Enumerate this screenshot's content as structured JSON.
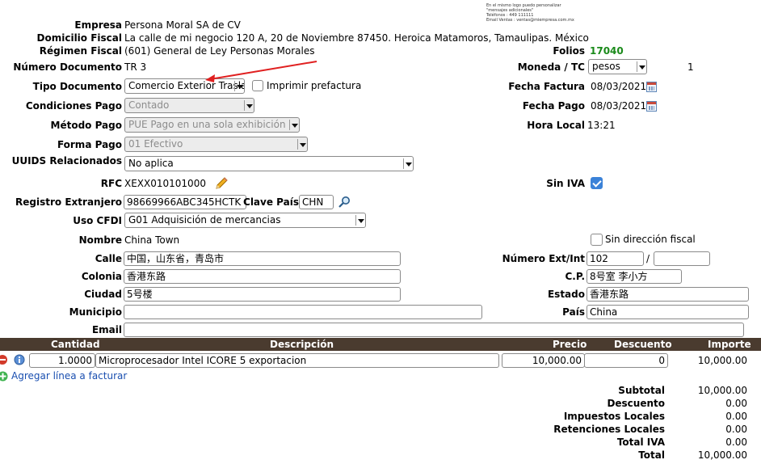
{
  "company": {
    "empresa_label": "Empresa",
    "empresa": "Persona Moral SA de CV",
    "domicilio_label": "Domicilio Fiscal",
    "domicilio": "La calle de mi negocio 120 A, 20 de Noviembre 87450. Heroica Matamoros, Tamaulipas. México",
    "regimen_label": "Régimen Fiscal",
    "regimen": "(601) General de Ley Personas Morales"
  },
  "logo_text": [
    "En el mismo logo puedo personalizar",
    "\"mensajes adicionales\"",
    "Teléfonos : 449 111111",
    "Email Ventas : ventas@miempresa.com.mx"
  ],
  "folios": {
    "label": "Folios",
    "value": "17040"
  },
  "numero_documento": {
    "label": "Número Documento",
    "value": "TR 3"
  },
  "moneda": {
    "label": "Moneda / TC",
    "value": "pesos",
    "tc": "1"
  },
  "tipo_documento": {
    "label": "Tipo Documento",
    "value": "Comercio Exterior Traslado"
  },
  "imprimir_prefactura": {
    "label": "Imprimir prefactura",
    "checked": false
  },
  "fecha_factura": {
    "label": "Fecha Factura",
    "value": "08/03/2021"
  },
  "condiciones_pago": {
    "label": "Condiciones Pago",
    "value": "Contado"
  },
  "fecha_pago": {
    "label": "Fecha Pago",
    "value": "08/03/2021"
  },
  "metodo_pago": {
    "label": "Método Pago",
    "value": "PUE Pago en una sola exhibición"
  },
  "hora_local": {
    "label": "Hora Local",
    "value": "13:21"
  },
  "forma_pago": {
    "label": "Forma Pago",
    "value": "01 Efectivo"
  },
  "uuids": {
    "label": "UUIDS Relacionados",
    "value": "No aplica"
  },
  "rfc": {
    "label": "RFC",
    "value": "XEXX010101000"
  },
  "sin_iva": {
    "label": "Sin IVA",
    "checked": true
  },
  "registro_extranjero": {
    "label": "Registro Extranjero",
    "value": "98669966ABC345HCTK"
  },
  "clave_pais": {
    "label": "Clave País",
    "value": "CHN"
  },
  "uso_cfdi": {
    "label": "Uso CFDI",
    "value": "G01 Adquisición de mercancias"
  },
  "nombre": {
    "label": "Nombre",
    "value": "China Town"
  },
  "sin_direccion": {
    "label": "Sin dirección fiscal",
    "checked": false
  },
  "calle": {
    "label": "Calle",
    "value": "中国，山东省，青岛市"
  },
  "numero_ext_int": {
    "label": "Número Ext/Int",
    "ext": "102",
    "sep": "/",
    "int": ""
  },
  "colonia": {
    "label": "Colonia",
    "value": "香港东路"
  },
  "cp": {
    "label": "C.P.",
    "value": "8号室 李小方"
  },
  "ciudad": {
    "label": "Ciudad",
    "value": "5号楼"
  },
  "estado": {
    "label": "Estado",
    "value": "香港东路"
  },
  "municipio": {
    "label": "Municipio",
    "value": ""
  },
  "pais": {
    "label": "País",
    "value": "China"
  },
  "email": {
    "label": "Email",
    "value": ""
  },
  "table": {
    "headers": {
      "cantidad": "Cantidad",
      "descripcion": "Descripción",
      "precio": "Precio",
      "descuento": "Descuento",
      "importe": "Importe"
    },
    "rows": [
      {
        "cantidad": "1.0000",
        "descripcion": "Microprocesador Intel ICORE 5 exportacion",
        "precio": "10,000.00",
        "descuento": "0",
        "importe": "10,000.00"
      }
    ],
    "add_line_label": "Agregar línea a facturar"
  },
  "totals": [
    {
      "label": "Subtotal",
      "value": "10,000.00"
    },
    {
      "label": "Descuento",
      "value": "0.00"
    },
    {
      "label": "Impuestos Locales",
      "value": "0.00"
    },
    {
      "label": "Retenciones Locales",
      "value": "0.00"
    },
    {
      "label": "Total IVA",
      "value": "0.00"
    },
    {
      "label": "Total",
      "value": "10,000.00"
    }
  ],
  "colors": {
    "folio_green": "#1a8a1a",
    "header_bg": "#4a3b2f",
    "arrow_red": "#e02020",
    "check_blue": "#3b82d8"
  }
}
